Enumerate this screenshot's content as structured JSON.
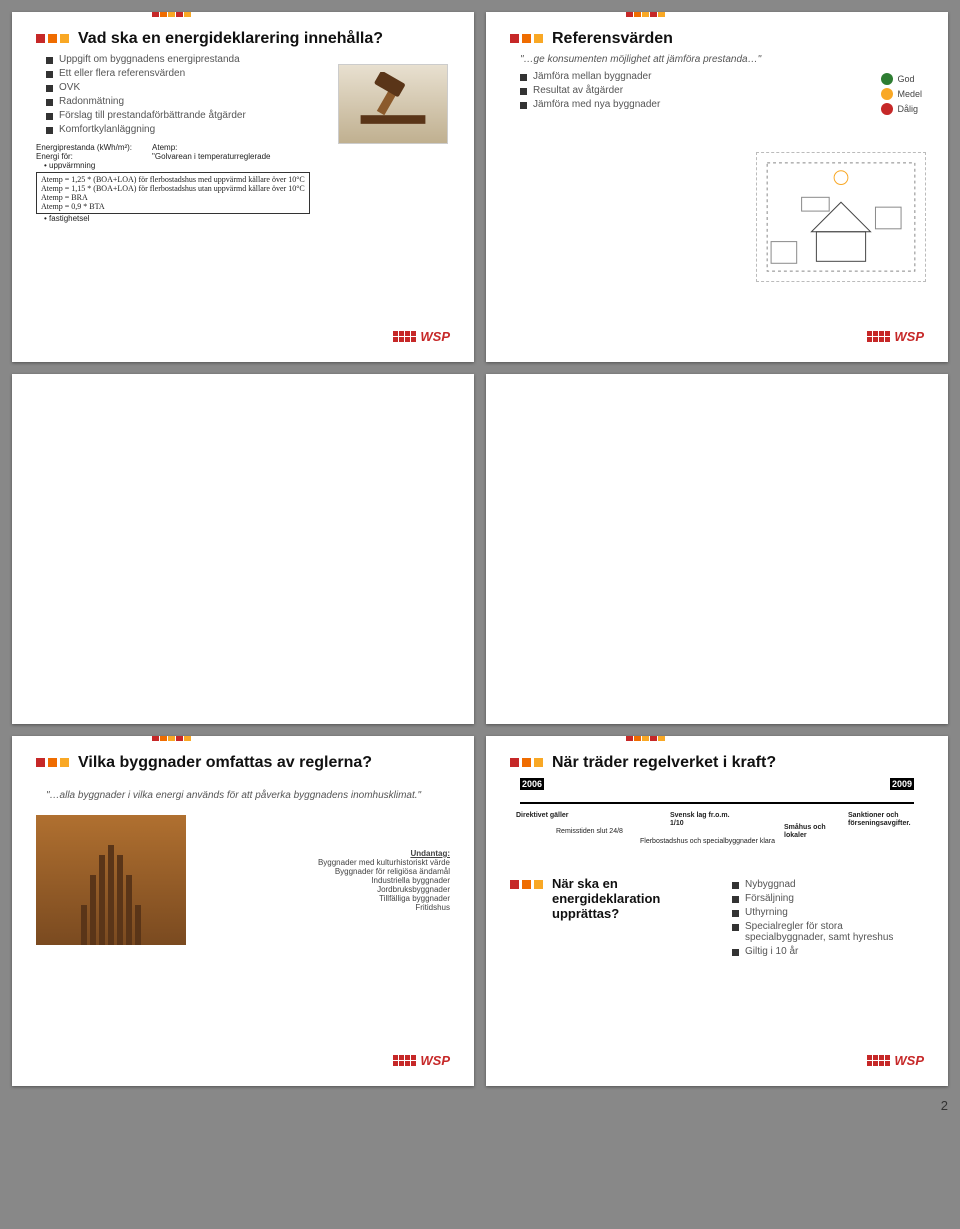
{
  "page_number": "2",
  "logo_text": "WSP",
  "slide1": {
    "title": "Vad ska en energideklarering innehålla?",
    "bullets": [
      "Uppgift om byggnadens energiprestanda",
      "Ett eller flera referensvärden",
      "OVK",
      "Radonmätning",
      "Förslag till prestandaförbättrande åtgärder",
      "Komfortkylanläggning"
    ],
    "energy_left_title": "Energiprestanda (kWh/m²):",
    "energy_left_sub": "Energi för:",
    "energy_left_items": [
      "uppvärmning",
      "fastighetsel"
    ],
    "energy_right_title": "Atemp:",
    "energy_right_sub": "\"Golvarean i temperaturreglerade",
    "formulas": [
      "Atemp = 1,25 * (BOA+LOA) för flerbostadshus med uppvärmd källare över 10°C",
      "Atemp = 1,15 * (BOA+LOA) för flerbostadshus utan uppvärmd källare över 10°C",
      "Atemp = BRA",
      "Atemp = 0,9 * BTA"
    ]
  },
  "slide2": {
    "title": "Referensvärden",
    "quote": "\"…ge konsumenten möjlighet att jämföra prestanda…\"",
    "bullets": [
      "Jämföra mellan byggnader",
      "Resultat av åtgärder",
      "Jämföra med nya byggnader"
    ],
    "ratings": [
      {
        "label": "God",
        "color": "#2e7d32"
      },
      {
        "label": "Medel",
        "color": "#f9a825"
      },
      {
        "label": "Dålig",
        "color": "#c62828"
      }
    ]
  },
  "slide5": {
    "title": "Vilka byggnader omfattas av reglerna?",
    "body": "\"…alla byggnader i vilka energi används för att påverka byggnadens inomhusklimat.\"",
    "exceptions_title": "Undantag:",
    "exceptions": [
      "Byggnader med kulturhistoriskt värde",
      "Byggnader för religiösa ändamål",
      "Industriella byggnader",
      "Jordbruksbyggnader",
      "Tillfälliga byggnader",
      "Fritidshus"
    ]
  },
  "slide6": {
    "title": "När träder regelverket i kraft?",
    "year_start": "2006",
    "year_end": "2009",
    "tl": {
      "direktivet": "Direktivet gäller",
      "remiss": "Remisstiden slut 24/8",
      "svensk": "Svensk lag fr.o.m. 1/10",
      "klara": "Flerbostadshus och specialbyggnader klara",
      "smahus": "Småhus och lokaler",
      "sanktioner": "Sanktioner och förseningsavgifter."
    },
    "q2_title": "När ska en energideklaration upprättas?",
    "q2_bullets": [
      "Nybyggnad",
      "Försäljning",
      "Uthyrning",
      "Specialregler för stora specialbyggnader, samt hyreshus",
      "Giltig i 10 år"
    ]
  }
}
